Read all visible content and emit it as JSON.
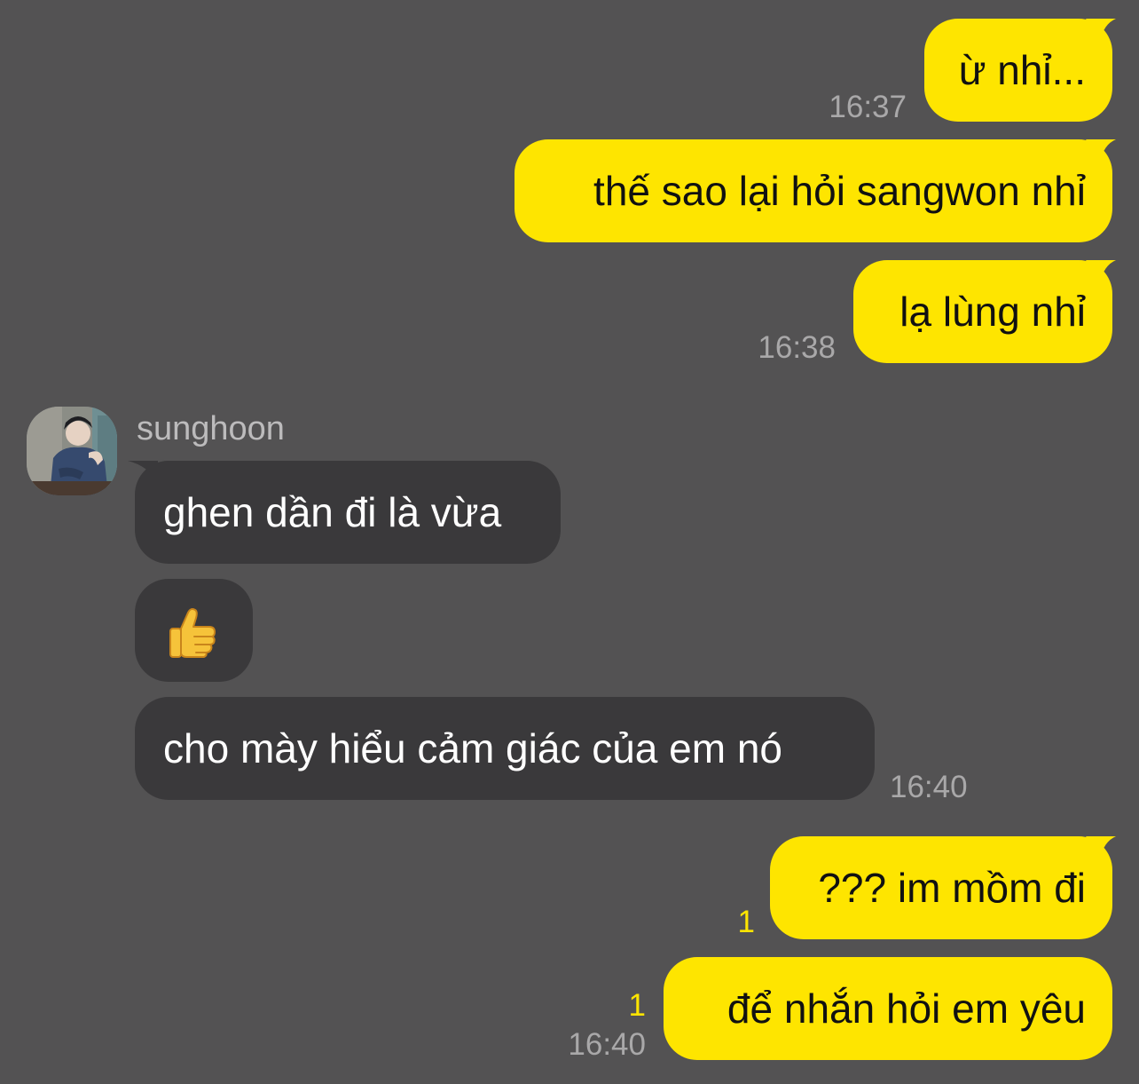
{
  "contact": {
    "name": "sunghoon"
  },
  "colors": {
    "background": "#535253",
    "outgoing_bubble": "#fee500",
    "incoming_bubble": "#3a393b",
    "timestamp": "#a9a8a9",
    "unread_count": "#fee500"
  },
  "messages": [
    {
      "direction": "out",
      "text": "ừ nhỉ...",
      "time": "16:37"
    },
    {
      "direction": "out",
      "text": "thế sao lại hỏi sangwon nhỉ"
    },
    {
      "direction": "out",
      "text": "lạ lùng nhỉ",
      "time": "16:38"
    },
    {
      "direction": "in",
      "sender": "sunghoon",
      "text": "ghen dần đi là vừa"
    },
    {
      "direction": "in",
      "text": "👍",
      "icon": "thumbs-up-emoji"
    },
    {
      "direction": "in",
      "text": "cho mày hiểu cảm giác của em nó",
      "time": "16:40"
    },
    {
      "direction": "out",
      "text": "??? im mồm đi",
      "unread": "1"
    },
    {
      "direction": "out",
      "text": "để nhắn hỏi em yêu",
      "unread": "1",
      "time": "16:40"
    }
  ]
}
